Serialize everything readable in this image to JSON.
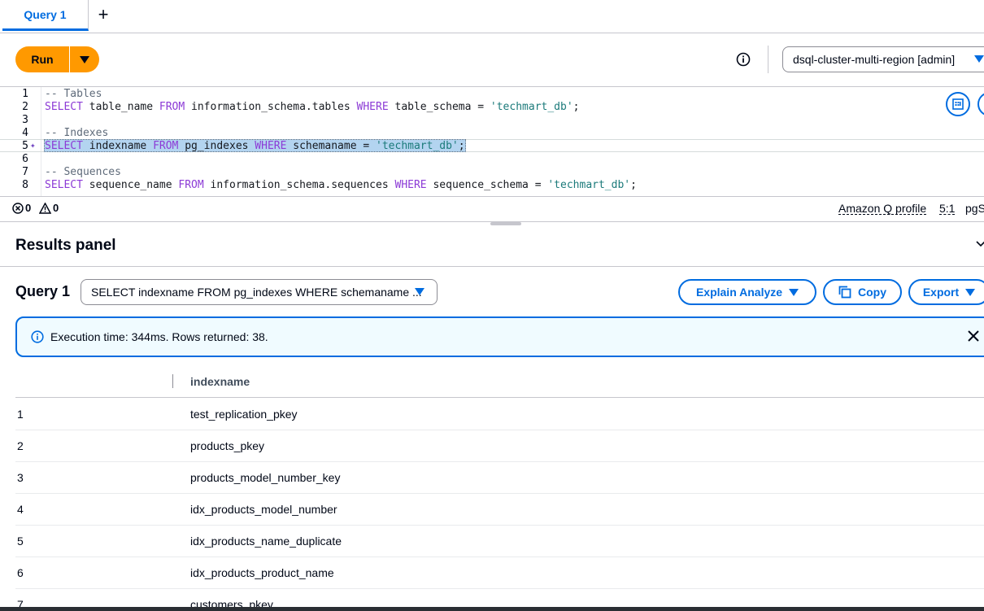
{
  "tabs": [
    {
      "label": "Query 1",
      "active": true
    }
  ],
  "toolbar": {
    "run_label": "Run",
    "cluster": "dsql-cluster-multi-region [admin]"
  },
  "editor": {
    "lines": [
      {
        "num": "1",
        "comment": "-- Tables"
      },
      {
        "num": "2",
        "sql": [
          "SELECT",
          " table_name ",
          "FROM",
          " information_schema.tables ",
          "WHERE",
          " table_schema = ",
          "'techmart_db'",
          ";"
        ]
      },
      {
        "num": "3"
      },
      {
        "num": "4",
        "comment": "-- Indexes"
      },
      {
        "num": "5",
        "sql": [
          "SELECT",
          " indexname ",
          "FROM",
          " pg_indexes ",
          "WHERE",
          " schemaname = ",
          "'techmart_db'",
          ";"
        ]
      },
      {
        "num": "6"
      },
      {
        "num": "7",
        "comment": "-- Sequences"
      },
      {
        "num": "8",
        "sql": [
          "SELECT",
          " sequence_name ",
          "FROM",
          " information_schema.sequences ",
          "WHERE",
          " sequence_schema = ",
          "'techmart_db'",
          ";"
        ]
      }
    ]
  },
  "status": {
    "errors": "0",
    "warnings": "0",
    "profile": "Amazon Q profile",
    "position": "5:1",
    "language": "pgS"
  },
  "results": {
    "title": "Results panel",
    "query_label": "Query 1",
    "query_select": "SELECT indexname FROM pg_indexes WHERE schemaname ...",
    "explain_label": "Explain Analyze",
    "copy_label": "Copy",
    "export_label": "Export",
    "alert": "Execution time: 344ms. Rows returned: 38.",
    "column": "indexname",
    "rows": [
      {
        "n": "1",
        "v": "test_replication_pkey"
      },
      {
        "n": "2",
        "v": "products_pkey"
      },
      {
        "n": "3",
        "v": "products_model_number_key"
      },
      {
        "n": "4",
        "v": "idx_products_model_number"
      },
      {
        "n": "5",
        "v": "idx_products_name_duplicate"
      },
      {
        "n": "6",
        "v": "idx_products_product_name"
      },
      {
        "n": "7",
        "v": "customers_pkey"
      }
    ]
  },
  "colors": {
    "accent": "#006ce0",
    "run": "#ff9900",
    "keyword": "#8c3bd6",
    "string": "#1b7a7a",
    "comment": "#5f6b7a"
  }
}
